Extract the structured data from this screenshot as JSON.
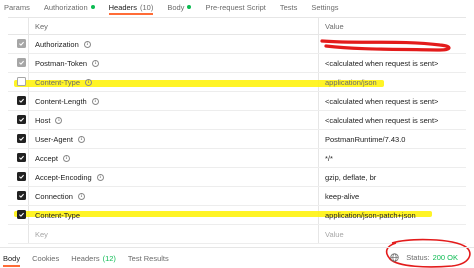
{
  "request_tabs": [
    {
      "label": "Params"
    },
    {
      "label": "Authorization",
      "dot_color": "#0cbb52"
    },
    {
      "label": "Headers",
      "count": "(10)",
      "active": true
    },
    {
      "label": "Body",
      "dot_color": "#0cbb52"
    },
    {
      "label": "Pre-request Script"
    },
    {
      "label": "Tests"
    },
    {
      "label": "Settings"
    }
  ],
  "table": {
    "key_header": "Key",
    "value_header": "Value",
    "rows": [
      {
        "key": "Authorization",
        "value": "",
        "state": "disabled",
        "info": true,
        "value_obscured": true
      },
      {
        "key": "Postman-Token",
        "value": "<calculated when request is sent>",
        "state": "disabled",
        "info": true
      },
      {
        "key": "Content-Type",
        "value": "application/json",
        "state": "unchecked",
        "info": true,
        "muted": true,
        "highlighted": true
      },
      {
        "key": "Content-Length",
        "value": "<calculated when request is sent>",
        "state": "checked",
        "info": true
      },
      {
        "key": "Host",
        "value": "<calculated when request is sent>",
        "state": "checked",
        "info": true
      },
      {
        "key": "User-Agent",
        "value": "PostmanRuntime/7.43.0",
        "state": "checked",
        "info": true
      },
      {
        "key": "Accept",
        "value": "*/*",
        "state": "checked",
        "info": true
      },
      {
        "key": "Accept-Encoding",
        "value": "gzip, deflate, br",
        "state": "checked",
        "info": true
      },
      {
        "key": "Connection",
        "value": "keep-alive",
        "state": "checked",
        "info": true
      },
      {
        "key": "Content-Type",
        "value": "application/json-patch+json",
        "state": "checked",
        "info": false,
        "highlighted": true
      }
    ],
    "placeholder_key": "Key",
    "placeholder_value": "Value"
  },
  "response_tabs": [
    {
      "label": "Body",
      "active": true
    },
    {
      "label": "Cookies"
    },
    {
      "label": "Headers",
      "count": "(12)"
    },
    {
      "label": "Test Results"
    }
  ],
  "status": {
    "label": "Status:",
    "value": "200 OK",
    "value_color": "#0cbb52"
  },
  "colors": {
    "accent": "#ff6c37",
    "highlight": "#fff200",
    "annotation": "#e31b1b"
  }
}
